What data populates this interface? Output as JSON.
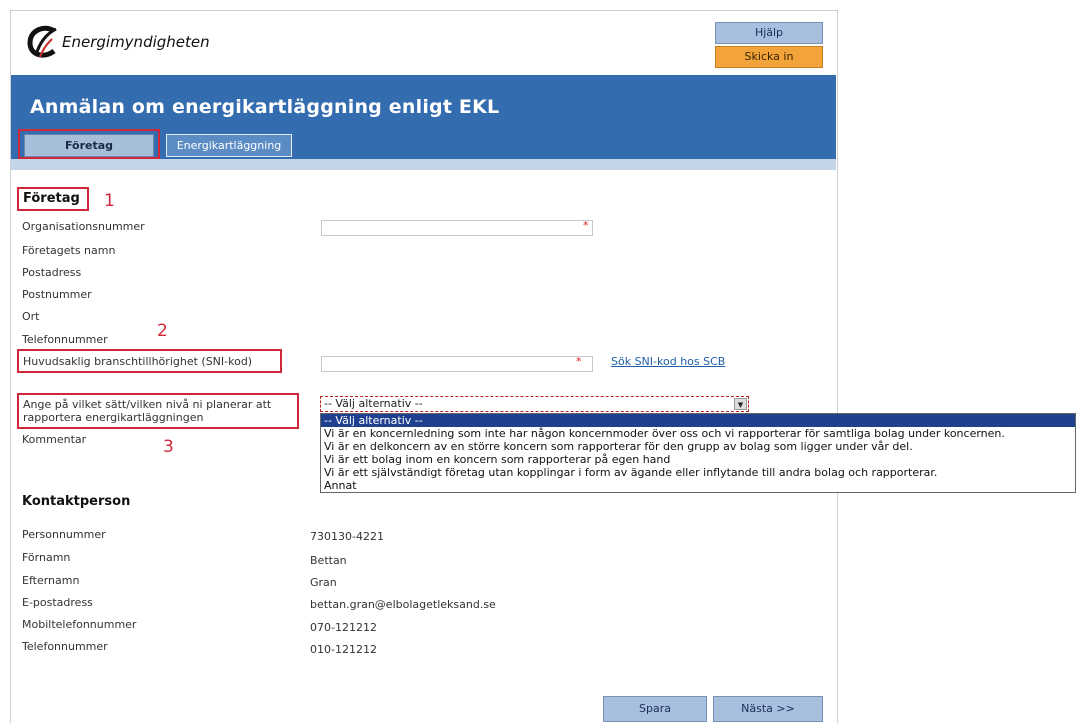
{
  "header": {
    "logo_text": "Energimyndigheten",
    "help_label": "Hjälp",
    "send_label": "Skicka in",
    "title": "Anmälan om energikartläggning enligt EKL"
  },
  "tabs": [
    {
      "label": "Företag",
      "active": true
    },
    {
      "label": "Energikartläggning",
      "active": false
    }
  ],
  "company": {
    "section_title": "Företag",
    "fields": {
      "org_nr": "Organisationsnummer",
      "name": "Företagets namn",
      "postal_address": "Postadress",
      "postal_code": "Postnummer",
      "city": "Ort",
      "phone": "Telefonnummer",
      "sni": "Huvudsaklig branschtillhörighet (SNI-kod)",
      "level_line1": "Ange på vilket sätt/vilken nivå ni planerar att",
      "level_line2": "rapportera energikartläggningen",
      "comment": "Kommentar"
    },
    "required_mark": "*",
    "sni_link": "Sök SNI-kod hos SCB",
    "select_value": "-- Välj alternativ --",
    "select_options": [
      "-- Välj alternativ --",
      "Vi är en koncernledning som inte har någon koncernmoder över oss och vi rapporterar för samtliga bolag under koncernen.",
      "Vi är en delkoncern av en större koncern som rapporterar för den grupp av bolag som ligger under vår del.",
      "Vi är ett bolag inom en koncern som rapporterar på egen hand",
      "Vi är ett självständigt företag utan kopplingar i form av ägande eller inflytande till andra bolag och rapporterar.",
      "Annat"
    ]
  },
  "annotations": {
    "n1": "1",
    "n2": "2",
    "n3": "3",
    "color": "#d0283a"
  },
  "contact": {
    "section_title": "Kontaktperson",
    "labels": {
      "personnummer": "Personnummer",
      "firstname": "Förnamn",
      "lastname": "Efternamn",
      "email": "E-postadress",
      "mobile": "Mobiltelefonnummer",
      "phone": "Telefonnummer"
    },
    "values": {
      "personnummer": "730130-4221",
      "firstname": "Bettan",
      "lastname": "Gran",
      "email": "bettan.gran@elbolagetleksand.se",
      "mobile": "070-121212",
      "phone": "010-121212"
    }
  },
  "footer": {
    "save_label": "Spara",
    "next_label": "Nästa >>"
  },
  "colors": {
    "banner": "#336caf",
    "send": "#f2a33a",
    "button": "#a8bfe0",
    "selected_option": "#1f3f8f"
  }
}
